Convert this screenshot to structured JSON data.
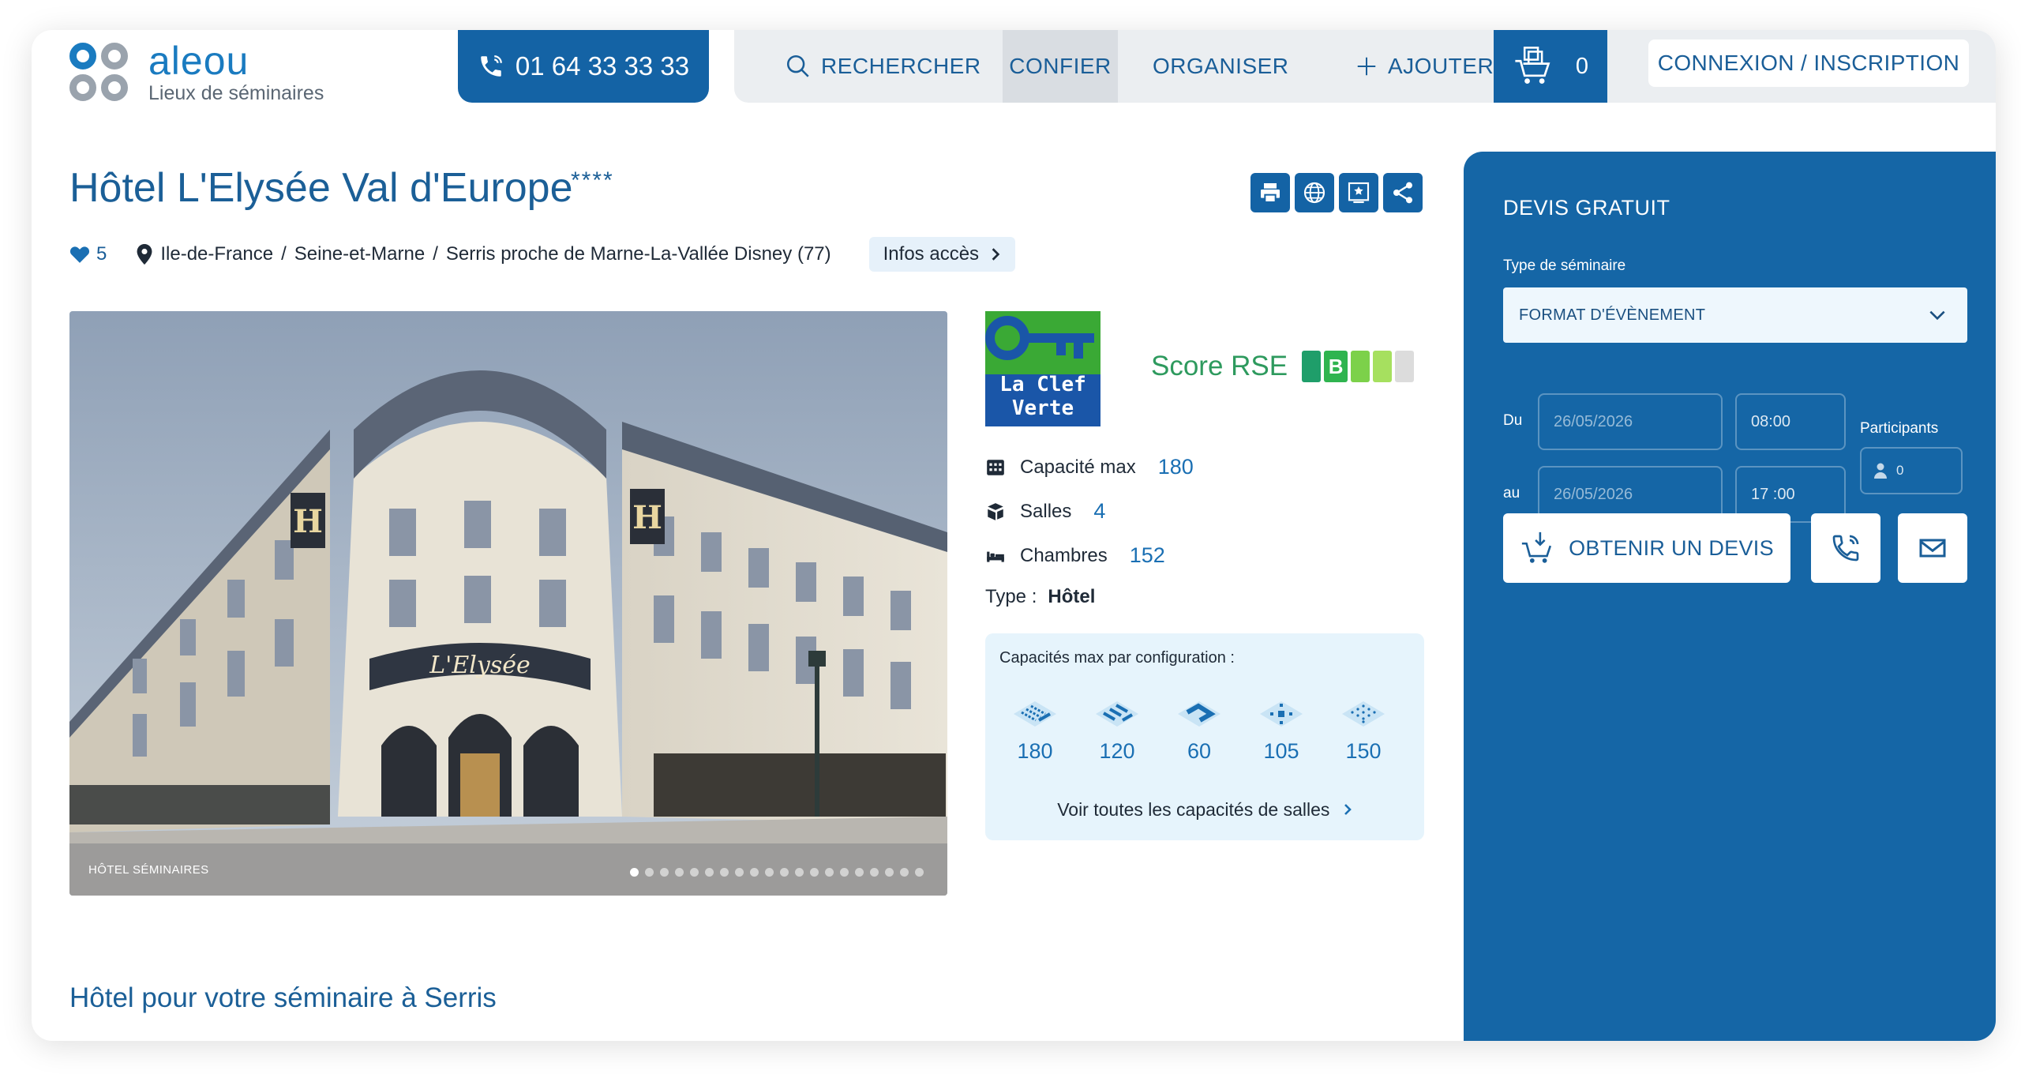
{
  "header": {
    "logo_wordmark": "aleou",
    "logo_tagline": "Lieux de séminaires",
    "phone": "01 64 33 33 33",
    "nav": [
      {
        "label": "RECHERCHER",
        "icon": "search-icon"
      },
      {
        "label": "CONFIER"
      },
      {
        "label": "ORGANISER"
      },
      {
        "label": "AJOUTER",
        "icon": "plus-icon"
      }
    ],
    "nav_active": "CONFIER",
    "cart_count": "0",
    "login_label": "CONNEXION / INSCRIPTION"
  },
  "venue": {
    "title": "Hôtel L'Elysée Val d'Europe",
    "stars": "****",
    "likes": "5",
    "breadcrumb": [
      "Ile-de-France",
      "Seine-et-Marne",
      "Serris proche de Marne-La-Vallée Disney (77)"
    ],
    "breadcrumb_sep": "/",
    "infos_label": "Infos accès",
    "photo_caption": "HÔTEL SÉMINAIRES",
    "photo_slide_count": 20,
    "photo_slide_active": 1,
    "sign_text": "L'Elysée",
    "facade_letter": "H"
  },
  "eco": {
    "badge_text_line1": "La Clef",
    "badge_text_line2": "Verte",
    "rse_label": "Score RSE",
    "rse_grade": "B",
    "rse_colors": [
      "#1f9e6a",
      "#2fb44f",
      "#7cd14a",
      "#a6e05f",
      "#dcdcdc"
    ]
  },
  "stats": {
    "capacity_label": "Capacité max",
    "capacity_value": "180",
    "rooms_label": "Salles",
    "rooms_value": "4",
    "bedrooms_label": "Chambres",
    "bedrooms_value": "152",
    "type_label": "Type :",
    "type_value": "Hôtel"
  },
  "capacities": {
    "heading": "Capacités max par configuration :",
    "items": [
      {
        "icon": "theatre-layout-icon",
        "value": "180"
      },
      {
        "icon": "classroom-layout-icon",
        "value": "120"
      },
      {
        "icon": "u-shape-layout-icon",
        "value": "60"
      },
      {
        "icon": "banquet-layout-icon",
        "value": "105"
      },
      {
        "icon": "cocktail-layout-icon",
        "value": "150"
      }
    ],
    "more_label": "Voir toutes les capacités de salles"
  },
  "section_heading": "Hôtel pour votre séminaire à Serris",
  "quote": {
    "heading": "DEVIS GRATUIT",
    "type_label": "Type de séminaire",
    "type_value": "FORMAT D'ÉVÈNEMENT",
    "from_label": "Du",
    "to_label": "au",
    "from_date": "26/05/2026",
    "to_date": "26/05/2026",
    "from_time": "08:00",
    "to_time": "17 :00",
    "participants_label": "Participants",
    "participants_value": "0",
    "submit_label": "OBTENIR UN DEVIS"
  },
  "colors": {
    "brand_blue": "#1463a5",
    "link_blue": "#1b5f97",
    "rse_green": "#2e9a5e"
  }
}
